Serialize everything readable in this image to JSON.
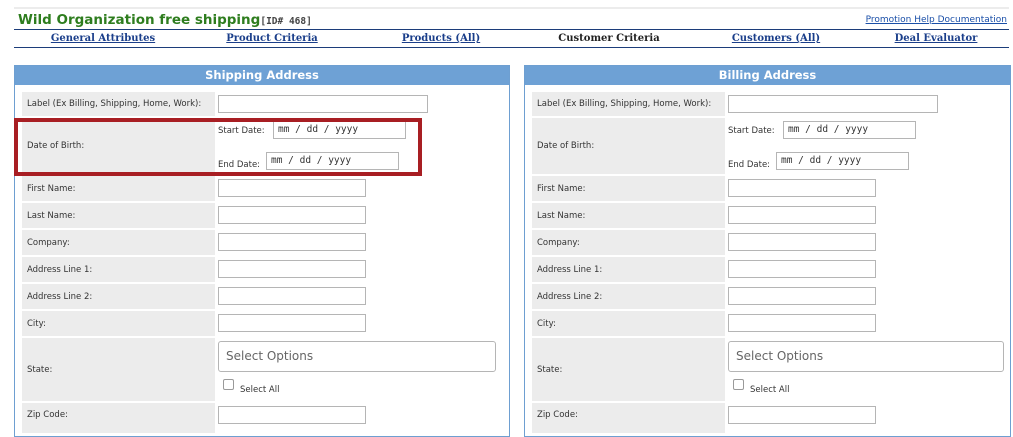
{
  "page": {
    "title": "Wild Organization free shipping",
    "id_label": "[ID# 468]",
    "help_link": "Promotion Help Documentation"
  },
  "tabs": [
    {
      "label": "General Attributes",
      "active": false
    },
    {
      "label": "Product Criteria",
      "active": false
    },
    {
      "label": "Products (All)",
      "active": false
    },
    {
      "label": "Customer Criteria",
      "active": true
    },
    {
      "label": "Customers (All)",
      "active": false
    },
    {
      "label": "Deal Evaluator",
      "active": false
    }
  ],
  "shipping": {
    "header": "Shipping Address",
    "label_field": "Label (Ex Billing, Shipping, Home, Work):",
    "dob": "Date of Birth:",
    "start_date": "Start Date:",
    "end_date": "End Date:",
    "date_placeholder": "mm / dd / yyyy",
    "first_name": "First Name:",
    "last_name": "Last Name:",
    "company": "Company:",
    "address1": "Address Line 1:",
    "address2": "Address Line 2:",
    "city": "City:",
    "state": "State:",
    "state_select": "Select Options",
    "select_all": "Select All",
    "zip": "Zip Code:"
  },
  "billing": {
    "header": "Billing Address",
    "label_field": "Label (Ex Billing, Shipping, Home, Work):",
    "dob": "Date of Birth:",
    "start_date": "Start Date:",
    "end_date": "End Date:",
    "date_placeholder": "mm / dd / yyyy",
    "first_name": "First Name:",
    "last_name": "Last Name:",
    "company": "Company:",
    "address1": "Address Line 1:",
    "address2": "Address Line 2:",
    "city": "City:",
    "state": "State:",
    "state_select": "Select Options",
    "select_all": "Select All",
    "zip": "Zip Code:"
  },
  "colors": {
    "title_green": "#2e7d1e",
    "tab_link": "#1a3e8a",
    "panel_header": "#6ea1d5",
    "highlight_red": "#a81e23"
  }
}
